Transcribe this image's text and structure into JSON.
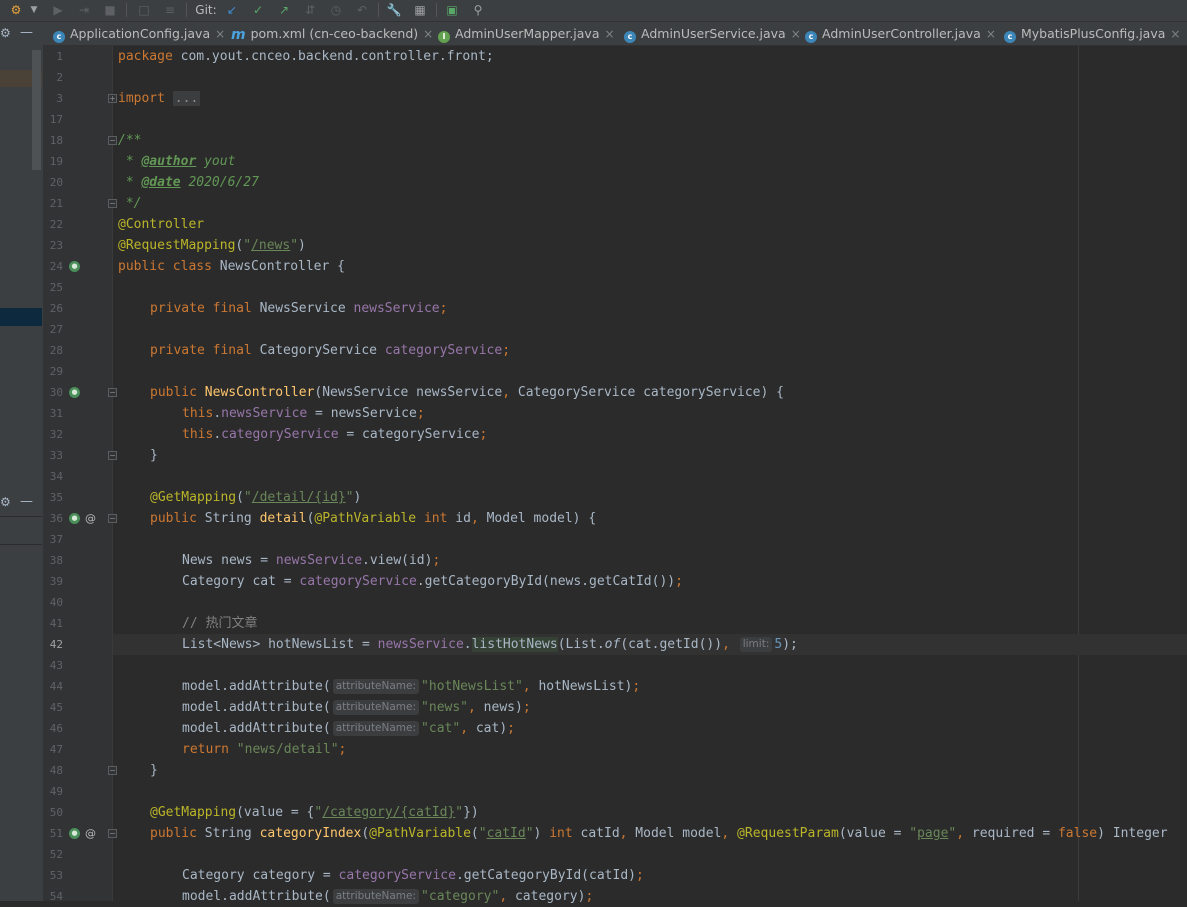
{
  "toolbar": {
    "git_label": "Git:",
    "icons": [
      "run-config-icon",
      "dropdown-icon",
      "debug-icon",
      "step-icon",
      "stop-icon",
      "coverage-icon",
      "profile-icon",
      "git-update-icon",
      "git-commit-icon",
      "git-push-icon",
      "git-compare-icon",
      "git-history-icon",
      "git-revert-icon",
      "settings-icon",
      "project-structure-icon",
      "terminal-icon",
      "search-icon"
    ]
  },
  "tabs": [
    {
      "label": "ApplicationConfig.java",
      "icon": "class-icon",
      "closable": true
    },
    {
      "label": "pom.xml (cn-ceo-backend)",
      "icon": "maven-icon",
      "closable": true
    },
    {
      "label": "AdminUserMapper.java",
      "icon": "interface-icon",
      "closable": true
    },
    {
      "label": "AdminUserService.java",
      "icon": "class-icon",
      "closable": true
    },
    {
      "label": "AdminUserController.java",
      "icon": "class-icon",
      "closable": true
    },
    {
      "label": "MybatisPlusConfig.java",
      "icon": "class-icon",
      "closable": true
    }
  ],
  "editor": {
    "current_line": "42",
    "line_numbers": [
      "1",
      "2",
      "3",
      "17",
      "18",
      "19",
      "20",
      "21",
      "22",
      "23",
      "24",
      "25",
      "26",
      "27",
      "28",
      "29",
      "30",
      "31",
      "32",
      "33",
      "34",
      "35",
      "36",
      "37",
      "38",
      "39",
      "40",
      "41",
      "42",
      "43",
      "44",
      "45",
      "46",
      "47",
      "48",
      "49",
      "50",
      "51",
      "52",
      "53",
      "54"
    ],
    "code": {
      "l1_kw": "package",
      "l1_rest": " com.yout.cnceo.backend.controller.front;",
      "l3_kw": "import",
      "l3_fold": "...",
      "l18": "/**",
      "l19_pre": " * ",
      "l19_tag": "@author",
      "l19_val": " yout",
      "l20_pre": " * ",
      "l20_tag": "@date",
      "l20_val": " 2020/6/27",
      "l21": " */",
      "l22": "@Controller",
      "l23_an": "@RequestMapping",
      "l23_open": "(",
      "l23_q1": "\"",
      "l23_path": "/news",
      "l23_q2": "\"",
      "l23_close": ")",
      "l24_kw": "public class",
      "l24_rest": " NewsController {",
      "l26_kw": "private final",
      "l26_type": " NewsService ",
      "l26_fld": "newsService",
      "l26_end": ";",
      "l28_kw": "private final",
      "l28_type": " CategoryService ",
      "l28_fld": "categoryService",
      "l28_end": ";",
      "l30_kw": "public",
      "l30_mth": "NewsController",
      "l30_p1": "(NewsService newsService",
      "l30_c1": ",",
      "l30_p2": " CategoryService categoryService) {",
      "l31_kw": "this",
      "l31_dot": ".",
      "l31_fld": "newsService",
      "l31_rest": " = newsService",
      "l31_end": ";",
      "l32_kw": "this",
      "l32_dot": ".",
      "l32_fld": "categoryService",
      "l32_rest": " = categoryService",
      "l32_end": ";",
      "l33": "}",
      "l35_an": "@GetMapping",
      "l35_open": "(",
      "l35_q1": "\"",
      "l35_path": "/detail/{id}",
      "l35_q2": "\"",
      "l35_close": ")",
      "l36_kw": "public",
      "l36_type": " String ",
      "l36_mth": "detail",
      "l36_open": "(",
      "l36_an": "@PathVariable",
      "l36_kw2": " int",
      "l36_p1": " id",
      "l36_c": ",",
      "l36_p2": " Model model) {",
      "l38_type": "News news = ",
      "l38_fld": "newsService",
      "l38_rest": ".view(id)",
      "l38_end": ";",
      "l39_type": "Category cat = ",
      "l39_fld": "categoryService",
      "l39_rest": ".getCategoryById(news.getCatId())",
      "l39_end": ";",
      "l41": "// 热门文章",
      "l42_type": "List<News> hotNewsList = ",
      "l42_fld": "newsService",
      "l42_dot": ".",
      "l42_mth": "listHotNews",
      "l42_a": "(List.",
      "l42_of": "of",
      "l42_b": "(cat.getId())",
      "l42_c": ",",
      "l42_hint": "limit:",
      "l42_num": "5",
      "l42_end": ");",
      "l44_pre": "model.addAttribute(",
      "l44_hint": "attributeName:",
      "l44_str": "\"hotNewsList\"",
      "l44_c": ",",
      "l44_rest": " hotNewsList)",
      "l44_end": ";",
      "l45_pre": "model.addAttribute(",
      "l45_hint": "attributeName:",
      "l45_str": "\"news\"",
      "l45_c": ",",
      "l45_rest": " news)",
      "l45_end": ";",
      "l46_pre": "model.addAttribute(",
      "l46_hint": "attributeName:",
      "l46_str": "\"cat\"",
      "l46_c": ",",
      "l46_rest": " cat)",
      "l46_end": ";",
      "l47_kw": "return",
      "l47_str": " \"news/detail\"",
      "l47_end": ";",
      "l48": "}",
      "l50_an": "@GetMapping",
      "l50_rest": "(value = {",
      "l50_q1": "\"",
      "l50_path": "/category/{catId}",
      "l50_q2": "\"",
      "l50_end": "})",
      "l51_kw": "public",
      "l51_type": " String ",
      "l51_mth": "categoryIndex",
      "l51_open": "(",
      "l51_an": "@PathVariable",
      "l51_p": "(",
      "l51_q1": "\"",
      "l51_arg": "catId",
      "l51_q2": "\"",
      "l51_pc": ")",
      "l51_kw2": " int",
      "l51_r1": " catId",
      "l51_c1": ",",
      "l51_r2": " Model model",
      "l51_c2": ",",
      "l51_an2": " @RequestParam",
      "l51_r3": "(value = ",
      "l51_q3": "\"",
      "l51_arg2": "page",
      "l51_q4": "\"",
      "l51_c3": ",",
      "l51_r4": " required = ",
      "l51_kw3": "false",
      "l51_r5": ") Integer",
      "l53_type": "Category category = ",
      "l53_fld": "categoryService",
      "l53_rest": ".getCategoryById(catId)",
      "l53_end": ";",
      "l54_pre": "model.addAttribute(",
      "l54_hint": "attributeName:",
      "l54_str": "\"category\"",
      "l54_c": ",",
      "l54_rest": " category)",
      "l54_end": ";"
    }
  }
}
